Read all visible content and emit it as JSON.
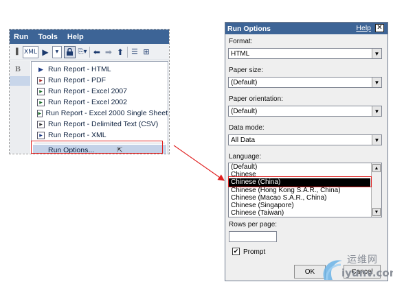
{
  "menubar": {
    "items": [
      "Run",
      "Tools",
      "Help"
    ]
  },
  "toolbar": {
    "xml_label": "XML"
  },
  "side": {
    "bold_label": "B"
  },
  "run_menu": {
    "items": [
      {
        "label": "Run Report - HTML",
        "icon": "play-icon"
      },
      {
        "label": "Run Report - PDF",
        "icon": "pdf-doc-icon"
      },
      {
        "label": "Run Report - Excel 2007",
        "icon": "excel-doc-icon"
      },
      {
        "label": "Run Report - Excel 2002",
        "icon": "excel-doc-icon"
      },
      {
        "label": "Run Report - Excel 2000 Single Sheet",
        "icon": "excel-doc-icon"
      },
      {
        "label": "Run Report - Delimited Text (CSV)",
        "icon": "csv-doc-icon"
      },
      {
        "label": "Run Report - XML",
        "icon": "xml-doc-icon"
      }
    ],
    "options_label": "Run Options..."
  },
  "dialog": {
    "title": "Run Options",
    "help_label": "Help",
    "close_label": "✕",
    "format": {
      "label": "Format:",
      "value": "HTML"
    },
    "paper_size": {
      "label": "Paper size:",
      "value": "(Default)"
    },
    "orientation": {
      "label": "Paper orientation:",
      "value": "(Default)"
    },
    "data_mode": {
      "label": "Data mode:",
      "value": "All Data"
    },
    "language": {
      "label": "Language:",
      "options": [
        "(Default)",
        "Chinese",
        "Chinese (China)",
        "Chinese (Hong Kong S.A.R., China)",
        "Chinese (Macao S.A.R., China)",
        "Chinese (Singapore)",
        "Chinese (Taiwan)"
      ],
      "selected": "Chinese (China)"
    },
    "rows_per_page": {
      "label": "Rows per page:",
      "value": ""
    },
    "prompt": {
      "label": "Prompt",
      "checked": true
    },
    "ok_label": "OK",
    "cancel_label": "Cancel"
  },
  "watermark": {
    "cn": "运维网",
    "en": "iyunv.com"
  },
  "colors": {
    "titlebar": "#3d6496",
    "callout": "#e02020"
  }
}
